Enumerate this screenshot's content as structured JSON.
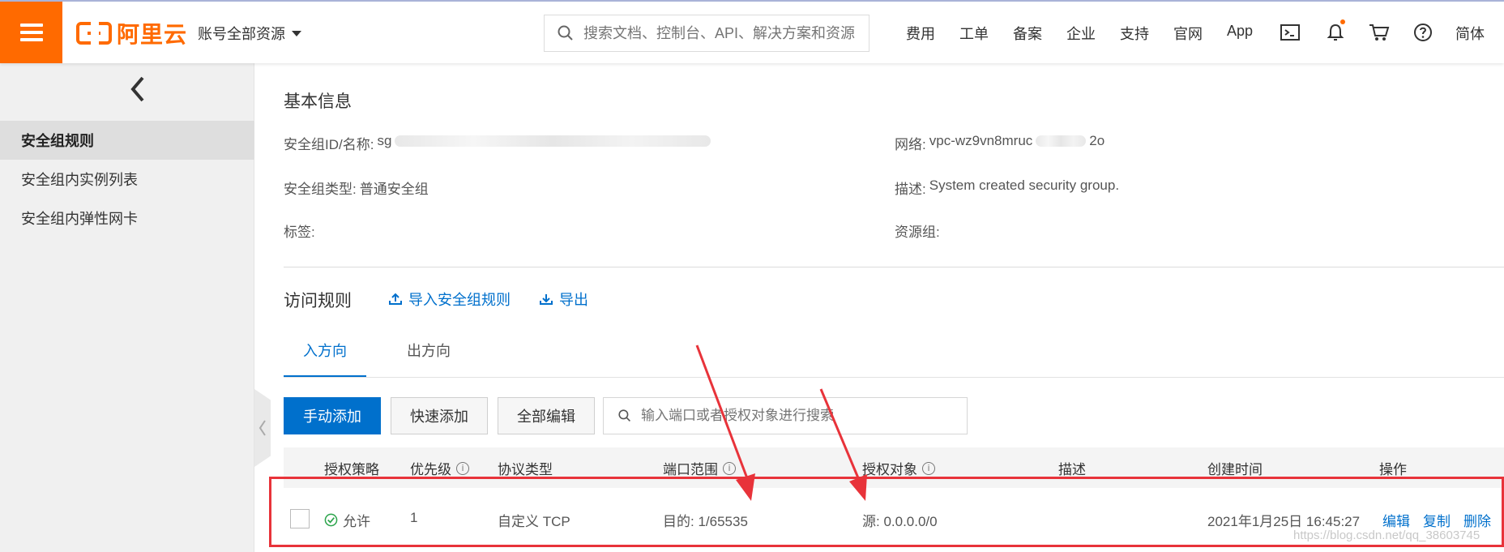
{
  "header": {
    "brand": "阿里云",
    "account_menu": "账号全部资源",
    "search_placeholder": "搜索文档、控制台、API、解决方案和资源",
    "nav": [
      "费用",
      "工单",
      "备案",
      "企业",
      "支持",
      "官网",
      "App"
    ],
    "lang": "简体",
    "brand_color": "#ff6a00"
  },
  "sidebar": {
    "items": [
      {
        "label": "安全组规则"
      },
      {
        "label": "安全组内实例列表"
      },
      {
        "label": "安全组内弹性网卡"
      }
    ]
  },
  "basic_info": {
    "title": "基本信息",
    "sg_label": "安全组ID/名称:",
    "sg_value": "sg",
    "network_label": "网络:",
    "network_value": "vpc-wz9vn8mruc",
    "network_suffix": "2o",
    "type_label": "安全组类型:",
    "type_value": "普通安全组",
    "desc_label": "描述:",
    "desc_value": "System created security group.",
    "tag_label": "标签:",
    "resource_group_label": "资源组:"
  },
  "access_rules": {
    "title": "访问规则",
    "import_label": "导入安全组规则",
    "export_label": "导出",
    "tabs": [
      "入方向",
      "出方向"
    ],
    "buttons": {
      "manual_add": "手动添加",
      "quick_add": "快速添加",
      "edit_all": "全部编辑"
    },
    "filter_placeholder": "输入端口或者授权对象进行搜索"
  },
  "table": {
    "headers": [
      "授权策略",
      "优先级",
      "协议类型",
      "端口范围",
      "授权对象",
      "描述",
      "创建时间",
      "操作"
    ],
    "row": {
      "policy": "允许",
      "priority": "1",
      "protocol": "自定义 TCP",
      "port": "目的: 1/65535",
      "source": "源: 0.0.0.0/0",
      "description": "",
      "created": "2021年1月25日 16:45:27",
      "actions": [
        "编辑",
        "复制",
        "删除"
      ]
    }
  },
  "watermark": "https://blog.csdn.net/qq_38603745",
  "colors": {
    "link": "#0070cc",
    "annotation": "#e8333a",
    "allow": "#2ba44b"
  }
}
